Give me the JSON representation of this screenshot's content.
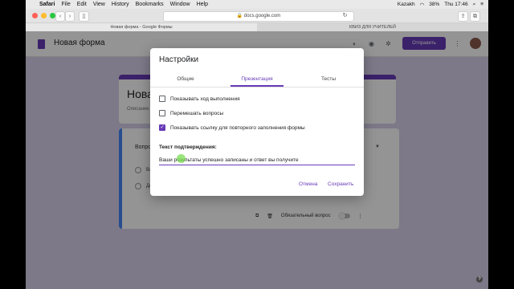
{
  "menubar": {
    "items": [
      "Safari",
      "File",
      "Edit",
      "View",
      "History",
      "Bookmarks",
      "Window",
      "Help"
    ],
    "status": {
      "user": "Kazakh",
      "battery": "38%",
      "time": "Thu 17:46"
    }
  },
  "browser": {
    "url": "docs.google.com",
    "tabs": [
      "Новая форма - Google Формы",
      "КВИЗ ДЛЯ УЧИТЕЛЕЙ"
    ]
  },
  "forms_header": {
    "title": "Новая форма",
    "send_label": "Отправить"
  },
  "form": {
    "title": "Нова",
    "description": "Описание",
    "question_label": "Вопрос",
    "options": [
      "Вари",
      "Доба"
    ],
    "required_label": "Обязательный вопрос"
  },
  "dialog": {
    "title": "Настройки",
    "tabs": [
      "Общие",
      "Презентация",
      "Тесты"
    ],
    "active_tab": "Презентация",
    "options": [
      {
        "label": "Показывать ход выполнения",
        "checked": false
      },
      {
        "label": "Перемешать вопросы",
        "checked": false
      },
      {
        "label": "Показывать ссылку для повторного заполнения формы",
        "checked": true
      }
    ],
    "confirm_label": "Текст подтверждения:",
    "confirm_value": "Ваши результаты успешно записаны и ответ вы получите",
    "cancel_label": "Отмена",
    "save_label": "Сохранить"
  },
  "colors": {
    "accent": "#673ab7",
    "question_border": "#4285f4"
  },
  "help_icon": "?"
}
